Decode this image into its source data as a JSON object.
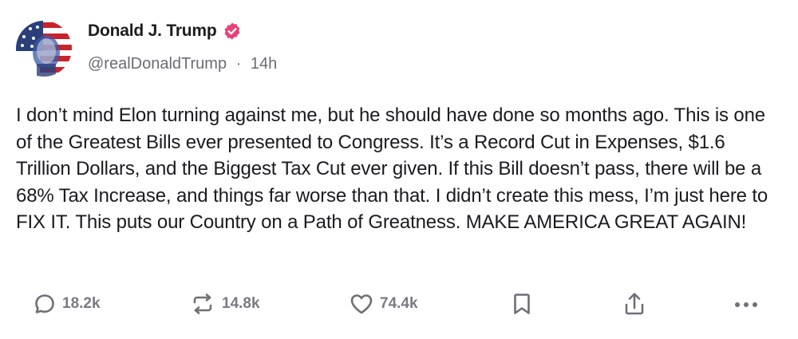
{
  "post": {
    "author": {
      "name": "Donald J. Trump",
      "handle": "@realDonaldTrump",
      "separator": "·",
      "time": "14h",
      "verified_color": "#e8417a"
    },
    "text": "I don’t mind Elon turning against me, but he should have done so months ago. This is one of the Greatest Bills ever presented to Congress. It’s a Record Cut in Expenses, $1.6 Trillion Dollars, and the Biggest Tax Cut ever given. If this Bill doesn’t pass, there will be a 68% Tax Increase, and things far worse than that. I didn’t create this mess, I’m just here to FIX IT. This puts our Country on a Path of Greatness. MAKE AMERICA GREAT AGAIN!",
    "actions": {
      "replies": {
        "icon": "reply-icon",
        "count": "18.2k"
      },
      "reposts": {
        "icon": "repost-icon",
        "count": "14.8k"
      },
      "likes": {
        "icon": "heart-icon",
        "count": "74.4k"
      },
      "bookmark": {
        "icon": "bookmark-icon"
      },
      "share": {
        "icon": "share-icon"
      },
      "more": {
        "icon": "more-icon"
      }
    }
  }
}
